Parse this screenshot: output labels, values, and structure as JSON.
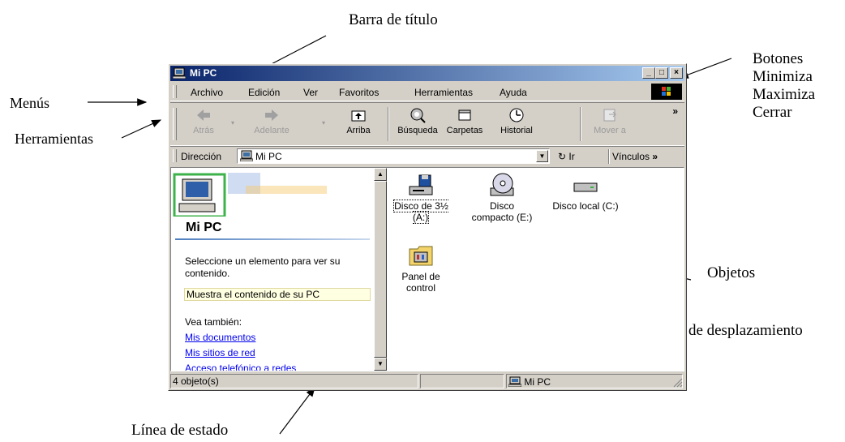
{
  "annotations": {
    "barra_titulo": "Barra de título",
    "botones": [
      "Botones",
      "Minimiza",
      "Maximiza",
      "Cerrar"
    ],
    "menus": "Menús",
    "herramientas": "Herramientas",
    "objetos": "Objetos",
    "barra_desplazamiento": "Barra de desplazamiento",
    "linea_estado": "Línea de estado"
  },
  "window": {
    "title": "Mi PC",
    "menu": [
      "Archivo",
      "Edición",
      "Ver",
      "Favoritos",
      "Herramientas",
      "Ayuda"
    ],
    "toolbar": {
      "back": "Atrás",
      "forward": "Adelante",
      "up": "Arriba",
      "search": "Búsqueda",
      "folders": "Carpetas",
      "history": "Historial",
      "move": "Mover a",
      "more": "»"
    },
    "address": {
      "label": "Dirección",
      "value": "Mi PC",
      "go": "Ir",
      "links": "Vínculos"
    },
    "left_pane": {
      "title": "Mi PC",
      "description": "Seleccione un elemento para ver su contenido.",
      "hover": "Muestra el contenido de su PC",
      "see_also": "Vea también:",
      "links": [
        "Mis documentos",
        "Mis sitios de red",
        "Acceso telefónico a redes"
      ]
    },
    "objects": [
      {
        "line1": "Disco de 3½",
        "line2": "(A:)",
        "icon": "floppy-drive-icon"
      },
      {
        "line1": "Disco",
        "line2": "compacto (E:)",
        "icon": "cd-drive-icon"
      },
      {
        "line1": "Disco local (C:)",
        "line2": "",
        "icon": "hard-drive-icon"
      },
      {
        "line1": "Panel de",
        "line2": "control",
        "icon": "control-panel-icon"
      }
    ],
    "status": {
      "count": "4 objeto(s)",
      "location": "Mi PC"
    },
    "colors": {
      "titlebar_start": "#0a246a",
      "titlebar_end": "#a6caf0",
      "face": "#d4d0c8",
      "link": "#0000ee"
    }
  }
}
